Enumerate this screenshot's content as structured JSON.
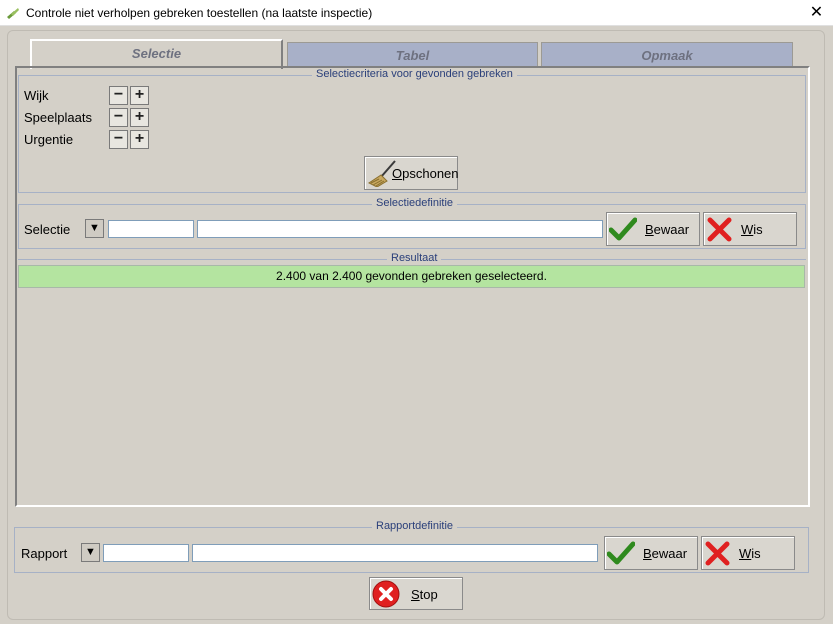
{
  "window": {
    "title": "Controle niet verholpen gebreken toestellen (na laatste inspectie)",
    "close": "✕"
  },
  "tabs": [
    {
      "label": "Selectie"
    },
    {
      "label": "Tabel"
    },
    {
      "label": "Opmaak"
    }
  ],
  "criteria": {
    "legend": "Selectiecriteria voor gevonden gebreken",
    "rows": [
      {
        "label": "Wijk"
      },
      {
        "label": "Speelplaats"
      },
      {
        "label": "Urgentie"
      }
    ],
    "minus": "−",
    "plus": "+",
    "clear_first": "O",
    "clear_rest": "pschonen"
  },
  "selectiedef": {
    "legend": "Selectiedefinitie",
    "label": "Selectie",
    "code_value": "",
    "name_value": "",
    "save_first": "B",
    "save_rest": "ewaar",
    "delete_first": "W",
    "delete_rest": "is"
  },
  "result": {
    "legend": "Resultaat",
    "text": "2.400 van 2.400 gevonden gebreken geselecteerd.",
    "bar_color": "#b4e4a0"
  },
  "rapportdef": {
    "legend": "Rapportdefinitie",
    "label": "Rapport",
    "code_value": "",
    "name_value": "",
    "save_first": "B",
    "save_rest": "ewaar",
    "delete_first": "W",
    "delete_rest": "is"
  },
  "stop": {
    "first": "S",
    "rest": "top"
  },
  "dropdown_glyph": "▼"
}
